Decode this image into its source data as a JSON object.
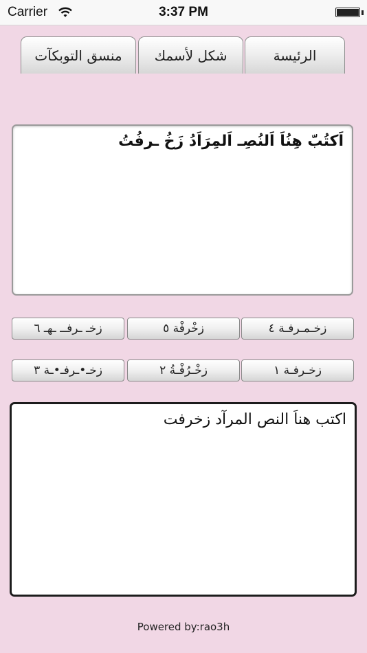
{
  "status_bar": {
    "carrier": "Carrier",
    "time": "3:37 PM",
    "wifi_icon": "wifi-icon",
    "battery_icon": "battery-icon",
    "battery_level": 1.0
  },
  "tabs": [
    {
      "label": "الرئيسة",
      "selected": true
    },
    {
      "label": "شكل لأسمك",
      "selected": false
    },
    {
      "label": "منسق التوبكآت",
      "selected": false
    }
  ],
  "input": {
    "text": "اَكتُبّ هِنُاَ اَلنُصِـ اَلمِرَاَدُ زَخُ ـرفُتُ"
  },
  "buttons": {
    "row1": [
      "زخـمـرفـة ٤",
      "زخْرفْة ٥",
      "زخـ ـرفــ ـهـ ٦"
    ],
    "row2": [
      "زخـرفـة ١",
      "زخْـرُفْـةُ ٢",
      "زخـ•ـرفـ•ـة ٣"
    ]
  },
  "output": {
    "text": "اكتب هناَ النص المرآد زخرفت"
  },
  "footer": {
    "text": "Powered by:rao3h"
  },
  "colors": {
    "background": "#f1d7e5",
    "status_bar": "#f8f8f8"
  }
}
